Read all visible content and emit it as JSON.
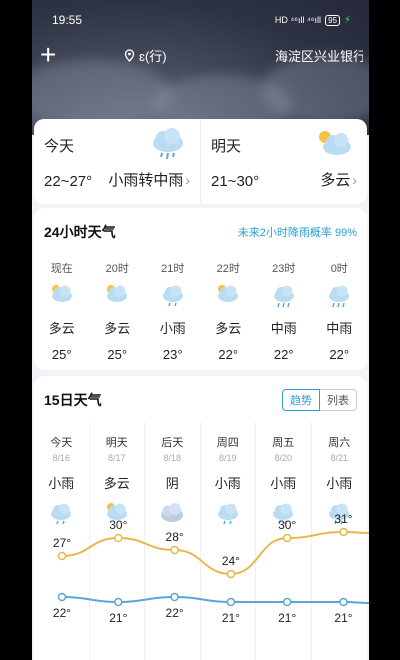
{
  "status": {
    "time": "19:55",
    "signal": "HD ⁴⁶ıll ⁴⁶ıll",
    "battery": "95"
  },
  "topbar": {
    "location_short": "ɛ(行)",
    "location_name": "海淀区兴业银行"
  },
  "today": {
    "label": "今天",
    "range": "22~27°",
    "condition": "小雨转中雨",
    "icon": "rain-cloud-icon"
  },
  "tomorrow": {
    "label": "明天",
    "range": "21~30°",
    "condition": "多云",
    "icon": "partly-cloudy-icon"
  },
  "hourly": {
    "title": "24小时天气",
    "rain_note": "未来2小时降雨概率 99%",
    "items": [
      {
        "time": "现在",
        "cond": "多云",
        "temp": "25°",
        "icon": "partly-cloudy-icon"
      },
      {
        "time": "20时",
        "cond": "多云",
        "temp": "25°",
        "icon": "partly-cloudy-icon"
      },
      {
        "time": "21时",
        "cond": "小雨",
        "temp": "23°",
        "icon": "light-rain-icon"
      },
      {
        "time": "22时",
        "cond": "多云",
        "temp": "22°",
        "icon": "partly-cloudy-icon"
      },
      {
        "time": "23时",
        "cond": "中雨",
        "temp": "22°",
        "icon": "moderate-rain-icon"
      },
      {
        "time": "0时",
        "cond": "中雨",
        "temp": "22°",
        "icon": "moderate-rain-icon"
      }
    ]
  },
  "daily": {
    "title": "15日天气",
    "toggle_on": "趋势",
    "toggle_off": "列表",
    "items": [
      {
        "day": "今天",
        "date": "8/16",
        "cond": "小雨",
        "icon": "light-rain-icon",
        "high": 27,
        "low": 22,
        "high_label": "27°",
        "low_label": "22°"
      },
      {
        "day": "明天",
        "date": "8/17",
        "cond": "多云",
        "icon": "partly-cloudy-icon",
        "high": 30,
        "low": 21,
        "high_label": "30°",
        "low_label": "21°"
      },
      {
        "day": "后天",
        "date": "8/18",
        "cond": "阴",
        "icon": "overcast-icon",
        "high": 28,
        "low": 22,
        "high_label": "28°",
        "low_label": "22°"
      },
      {
        "day": "周四",
        "date": "8/19",
        "cond": "小雨",
        "icon": "light-rain-icon",
        "high": 24,
        "low": 21,
        "high_label": "24°",
        "low_label": "21°"
      },
      {
        "day": "周五",
        "date": "8/20",
        "cond": "小雨",
        "icon": "light-rain-icon",
        "high": 30,
        "low": 21,
        "high_label": "30°",
        "low_label": "21°"
      },
      {
        "day": "周六",
        "date": "8/21",
        "cond": "小雨",
        "icon": "light-rain-icon",
        "high": 31,
        "low": 21,
        "high_label": "31°",
        "low_label": "21°"
      }
    ]
  },
  "colors": {
    "high_line": "#e8b84a",
    "low_line": "#5aa6d6",
    "accent": "#2a9fd8"
  }
}
